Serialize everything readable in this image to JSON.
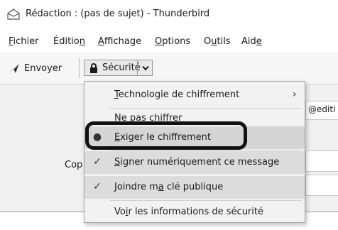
{
  "window": {
    "title": "Rédaction : (pas de sujet) - Thunderbird"
  },
  "menubar": {
    "items": [
      {
        "pre": "",
        "u": "F",
        "post": "ichier"
      },
      {
        "pre": "Éditio",
        "u": "n",
        "post": ""
      },
      {
        "pre": "",
        "u": "A",
        "post": "ffichage"
      },
      {
        "pre": "",
        "u": "O",
        "post": "ptions"
      },
      {
        "pre": "O",
        "u": "u",
        "post": "tils"
      },
      {
        "pre": "Aid",
        "u": "e",
        "post": ""
      }
    ]
  },
  "toolbar": {
    "send_label": "Envoyer",
    "security_label": "Sécurité"
  },
  "compose": {
    "address_fragment": "@editi",
    "cc_label_fragment": "Cop"
  },
  "security_menu": {
    "items": [
      {
        "pre": "",
        "u": "T",
        "post": "echnologie de chiffrement",
        "state": "submenu"
      },
      {
        "pre": "",
        "u": "N",
        "post": "e pas chiffrer",
        "state": "none"
      },
      {
        "pre": "",
        "u": "E",
        "post": "xiger le chiffrement",
        "state": "radio-selected"
      },
      {
        "pre": "",
        "u": "S",
        "post": "igner numériquement ce message",
        "state": "checked"
      },
      {
        "pre": "Joindre m",
        "u": "a",
        "post": " clé publique",
        "state": "checked"
      },
      {
        "pre": "Vo",
        "u": "i",
        "post": "r les informations de sécurité",
        "state": "none"
      }
    ]
  },
  "colors": {
    "menu_bg": "#f2f2f2",
    "highlight_ring": "#111111"
  }
}
